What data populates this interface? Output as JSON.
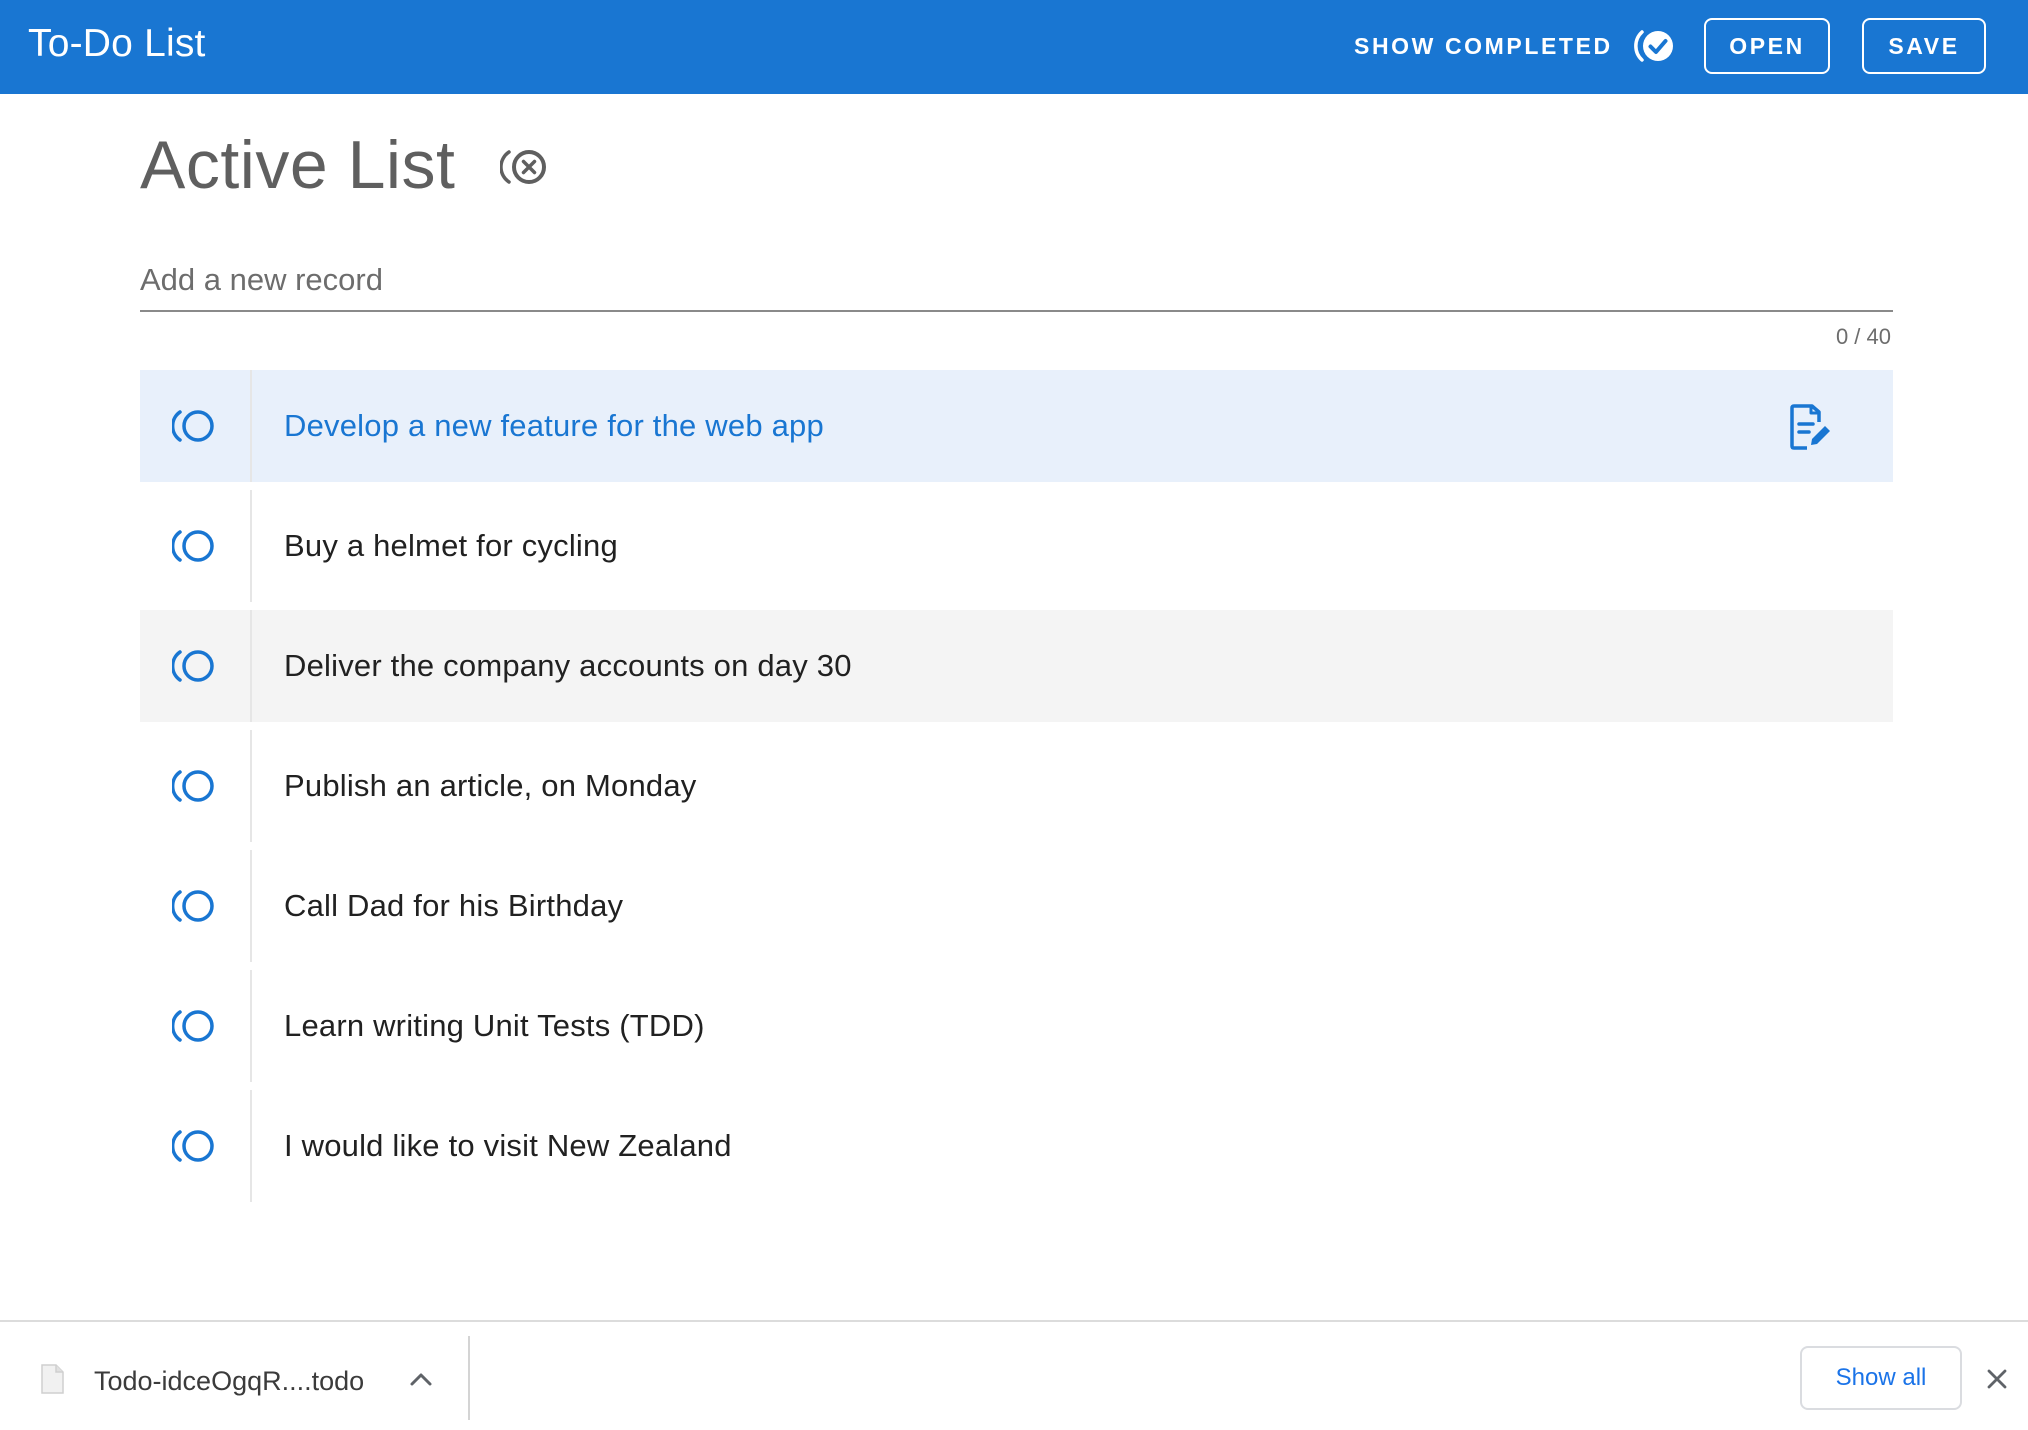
{
  "appbar": {
    "title": "To-Do List",
    "show_completed_label": "SHOW COMPLETED",
    "show_completed_icon": "check-circle-icon",
    "open_label": "OPEN",
    "save_label": "SAVE",
    "background_color": "#1976d2"
  },
  "list": {
    "title": "Active List",
    "clear_icon": "clear-list-icon",
    "input_placeholder": "Add a new record",
    "input_value": "",
    "char_counter": "0 / 40",
    "items": [
      {
        "text": "Develop a new feature for the web app",
        "state": "active"
      },
      {
        "text": "Buy a helmet for cycling",
        "state": "normal"
      },
      {
        "text": "Deliver the company accounts on day 30",
        "state": "hovered"
      },
      {
        "text": "Publish an article, on Monday",
        "state": "normal"
      },
      {
        "text": "Call Dad for his Birthday",
        "state": "normal"
      },
      {
        "text": "Learn writing Unit Tests (TDD)",
        "state": "normal"
      },
      {
        "text": "I would like to visit New Zealand",
        "state": "normal"
      }
    ],
    "item_icon": "circle-status-icon",
    "edit_icon": "edit-document-icon",
    "accent_color": "#1976d2"
  },
  "download_shelf": {
    "file_name": "Todo-idceOgqR....todo",
    "show_all_label": "Show all",
    "file_icon": "file-icon",
    "chevron_icon": "chevron-up-icon",
    "close_icon": "close-icon"
  }
}
